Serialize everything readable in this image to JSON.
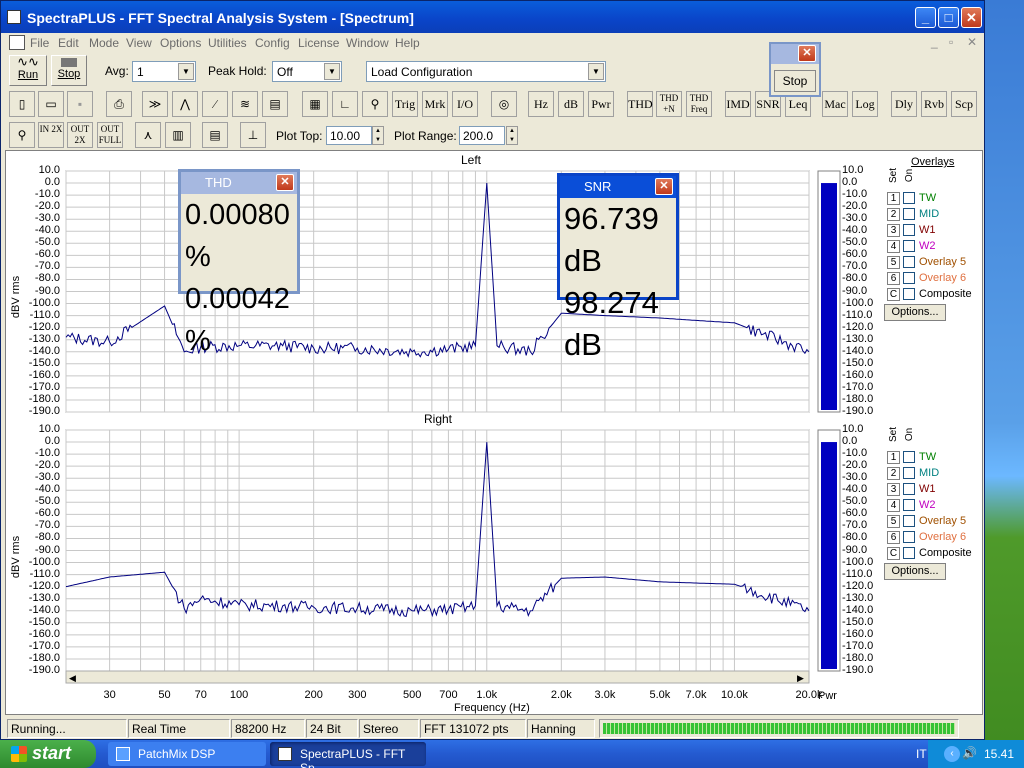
{
  "window": {
    "title": "SpectraPLUS - FFT Spectral Analysis System - [Spectrum]"
  },
  "menu": [
    "File",
    "Edit",
    "Mode",
    "View",
    "Options",
    "Utilities",
    "Config",
    "License",
    "Window",
    "Help"
  ],
  "toolbar1": {
    "run_label": "Run",
    "stop_label": "Stop",
    "avg_label": "Avg:",
    "avg_value": "1",
    "peak_hold_label": "Peak Hold:",
    "peak_hold_value": "Off",
    "load_config_value": "Load Configuration"
  },
  "toolbar2": {
    "trig": "Trig",
    "mrk": "Mrk",
    "io": "I/O",
    "hz": "Hz",
    "db": "dB",
    "pwr": "Pwr",
    "thd": "THD",
    "thdn": "THD +N",
    "thdfreq": "THD Freq",
    "imd": "IMD",
    "snr": "SNR",
    "leq": "Leq",
    "mac": "Mac",
    "log": "Log",
    "dly": "Dly",
    "rvb": "Rvb",
    "scp": "Scp"
  },
  "toolbar3": {
    "zoom_in": "IN 2X",
    "zoom_out": "OUT 2X",
    "zoom_full": "OUT FULL",
    "plot_top_label": "Plot Top:",
    "plot_top_value": "10.00",
    "plot_range_label": "Plot Range:",
    "plot_range_value": "200.0"
  },
  "stop_popup": {
    "label": "Stop"
  },
  "thd_window": {
    "title": "THD",
    "value1": "0.00080 %",
    "value2": "0.00042 %"
  },
  "snr_window": {
    "title": "SNR",
    "value1": "96.739 dB",
    "value2": "98.274 dB"
  },
  "graph": {
    "left_title": "Left",
    "right_title": "Right",
    "y_axis_label": "dBV rms",
    "x_axis_label": "Frequency (Hz)",
    "pwr_label": "Pwr",
    "y_ticks": [
      "10.0",
      "0.0",
      "-10.0",
      "-20.0",
      "-30.0",
      "-40.0",
      "-50.0",
      "-60.0",
      "-70.0",
      "-80.0",
      "-90.0",
      "-100.0",
      "-110.0",
      "-120.0",
      "-130.0",
      "-140.0",
      "-150.0",
      "-160.0",
      "-170.0",
      "-180.0",
      "-190.0"
    ],
    "x_ticks": [
      "30",
      "50",
      "70",
      "100",
      "200",
      "300",
      "500",
      "700",
      "1.0k",
      "2.0k",
      "3.0k",
      "5.0k",
      "7.0k",
      "10.0k",
      "20.0k"
    ],
    "trace_color": "#000080",
    "meter_color": "#0000c0"
  },
  "overlays": {
    "title": "Overlays",
    "set_label": "Set",
    "on_label": "On",
    "options_label": "Options...",
    "items": [
      {
        "num": "1",
        "name": "TW",
        "color": "#008000"
      },
      {
        "num": "2",
        "name": "MID",
        "color": "#008080"
      },
      {
        "num": "3",
        "name": "W1",
        "color": "#800000"
      },
      {
        "num": "4",
        "name": "W2",
        "color": "#c000c0"
      },
      {
        "num": "5",
        "name": "Overlay 5",
        "color": "#a05000"
      },
      {
        "num": "6",
        "name": "Overlay 6",
        "color": "#e07040"
      },
      {
        "num": "C",
        "name": "Composite",
        "color": "#000000"
      }
    ]
  },
  "status": {
    "state": "Running...",
    "mode": "Real Time",
    "rate": "88200 Hz",
    "bits": "24 Bit",
    "channels": "Stereo",
    "fft": "FFT 131072 pts",
    "window": "Hanning"
  },
  "taskbar": {
    "start": "start",
    "task1": "PatchMix DSP",
    "task2": "SpectraPLUS - FFT Sp...",
    "lang": "IT",
    "clock": "15.41"
  },
  "chart_data": [
    {
      "type": "line",
      "title": "Left",
      "xlabel": "Frequency (Hz)",
      "ylabel": "dBV rms",
      "xscale": "log",
      "xlim": [
        20,
        20000
      ],
      "ylim": [
        -190,
        10
      ],
      "series": [
        {
          "x": [
            20,
            30,
            50,
            60,
            70,
            100,
            150,
            200,
            300,
            500,
            700,
            900,
            1000,
            1100,
            1500,
            2000,
            3000,
            5000,
            7000,
            10000,
            20000
          ],
          "y": [
            -128,
            -132,
            -102,
            -140,
            -136,
            -135,
            -135,
            -137,
            -137,
            -140,
            -138,
            -135,
            0,
            -135,
            -140,
            -108,
            -110,
            -112,
            -114,
            -116,
            -140
          ]
        }
      ]
    },
    {
      "type": "line",
      "title": "Right",
      "xlabel": "Frequency (Hz)",
      "ylabel": "dBV rms",
      "xscale": "log",
      "xlim": [
        20,
        20000
      ],
      "ylim": [
        -190,
        10
      ],
      "series": [
        {
          "x": [
            20,
            30,
            50,
            60,
            70,
            100,
            150,
            200,
            300,
            500,
            700,
            900,
            1000,
            1100,
            1500,
            2000,
            3000,
            5000,
            7000,
            10000,
            20000
          ],
          "y": [
            -120,
            -112,
            -108,
            -138,
            -130,
            -135,
            -136,
            -137,
            -138,
            -140,
            -139,
            -136,
            0,
            -136,
            -140,
            -113,
            -112,
            -116,
            -117,
            -118,
            -140
          ]
        }
      ]
    }
  ]
}
